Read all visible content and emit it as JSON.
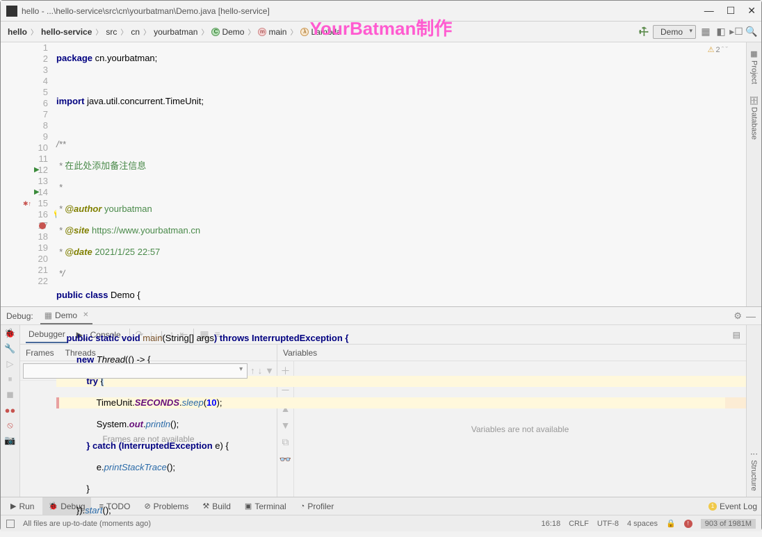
{
  "window": {
    "title": "hello - ...\\hello-service\\src\\cn\\yourbatman\\Demo.java [hello-service]"
  },
  "watermark": "YourBatman制作",
  "breadcrumb": [
    "hello",
    "hello-service",
    "src",
    "cn",
    "yourbatman",
    "Demo",
    "main",
    "Lambda"
  ],
  "run_config": "Demo",
  "error_indicator": {
    "warn_count": "2"
  },
  "right_tabs": {
    "project": "Project",
    "database": "Database",
    "structure": "Structure"
  },
  "code": {
    "l1": "package cn.yourbatman;",
    "l3": "import java.util.concurrent.TimeUnit;",
    "l5": "/**",
    "l6": " * 在此处添加备注信息",
    "l7": " *",
    "l8": " * @author yourbatman",
    "l9": " * @site https://www.yourbatman.cn",
    "l10": " * @date 2021/1/25 22:57",
    "l11": " */",
    "l12_a": "public class ",
    "l12_b": "Demo",
    "l12_c": " {",
    "l14_a": "    public static void ",
    "l14_b": "main",
    "l14_c": "(String[] ",
    "l14_d": "args",
    "l14_e": ") throws InterruptedException {",
    "l15_a": "        new ",
    "l15_b": "Thread",
    "l15_c": "(() -> {",
    "l16_a": "            try ",
    "l16_b": "{",
    "l17_a": "                TimeUnit.",
    "l17_b": "SECONDS",
    "l17_c": ".",
    "l17_d": "sleep",
    "l17_e": "(",
    "l17_f": "10",
    "l17_g": ");",
    "l18_a": "                System.",
    "l18_b": "out",
    "l18_c": ".",
    "l18_d": "println",
    "l18_e": "();",
    "l19_a": "            } catch (InterruptedException ",
    "l19_b": "e",
    "l19_c": ") {",
    "l20_a": "                ",
    "l20_b": "e",
    "l20_c": ".",
    "l20_d": "printStackTrace",
    "l20_e": "();",
    "l21": "            }",
    "l22_a": "        }).",
    "l22_b": "start",
    "l22_c": "();"
  },
  "debug": {
    "title": "Debug:",
    "config": "Demo",
    "tab_debugger": "Debugger",
    "tab_console": "Console",
    "frames_tab": "Frames",
    "threads_tab": "Threads",
    "variables_tab": "Variables",
    "frames_empty": "Frames are not available",
    "variables_empty": "Variables are not available"
  },
  "bottom_tabs": {
    "run": "Run",
    "debug": "Debug",
    "todo": "TODO",
    "problems": "Problems",
    "build": "Build",
    "terminal": "Terminal",
    "profiler": "Profiler",
    "eventlog": "Event Log",
    "event_count": "1"
  },
  "status": {
    "msg": "All files are up-to-date (moments ago)",
    "time": "16:18",
    "line_sep": "CRLF",
    "encoding": "UTF-8",
    "indent": "4 spaces",
    "mem": "903 of 1981M"
  }
}
